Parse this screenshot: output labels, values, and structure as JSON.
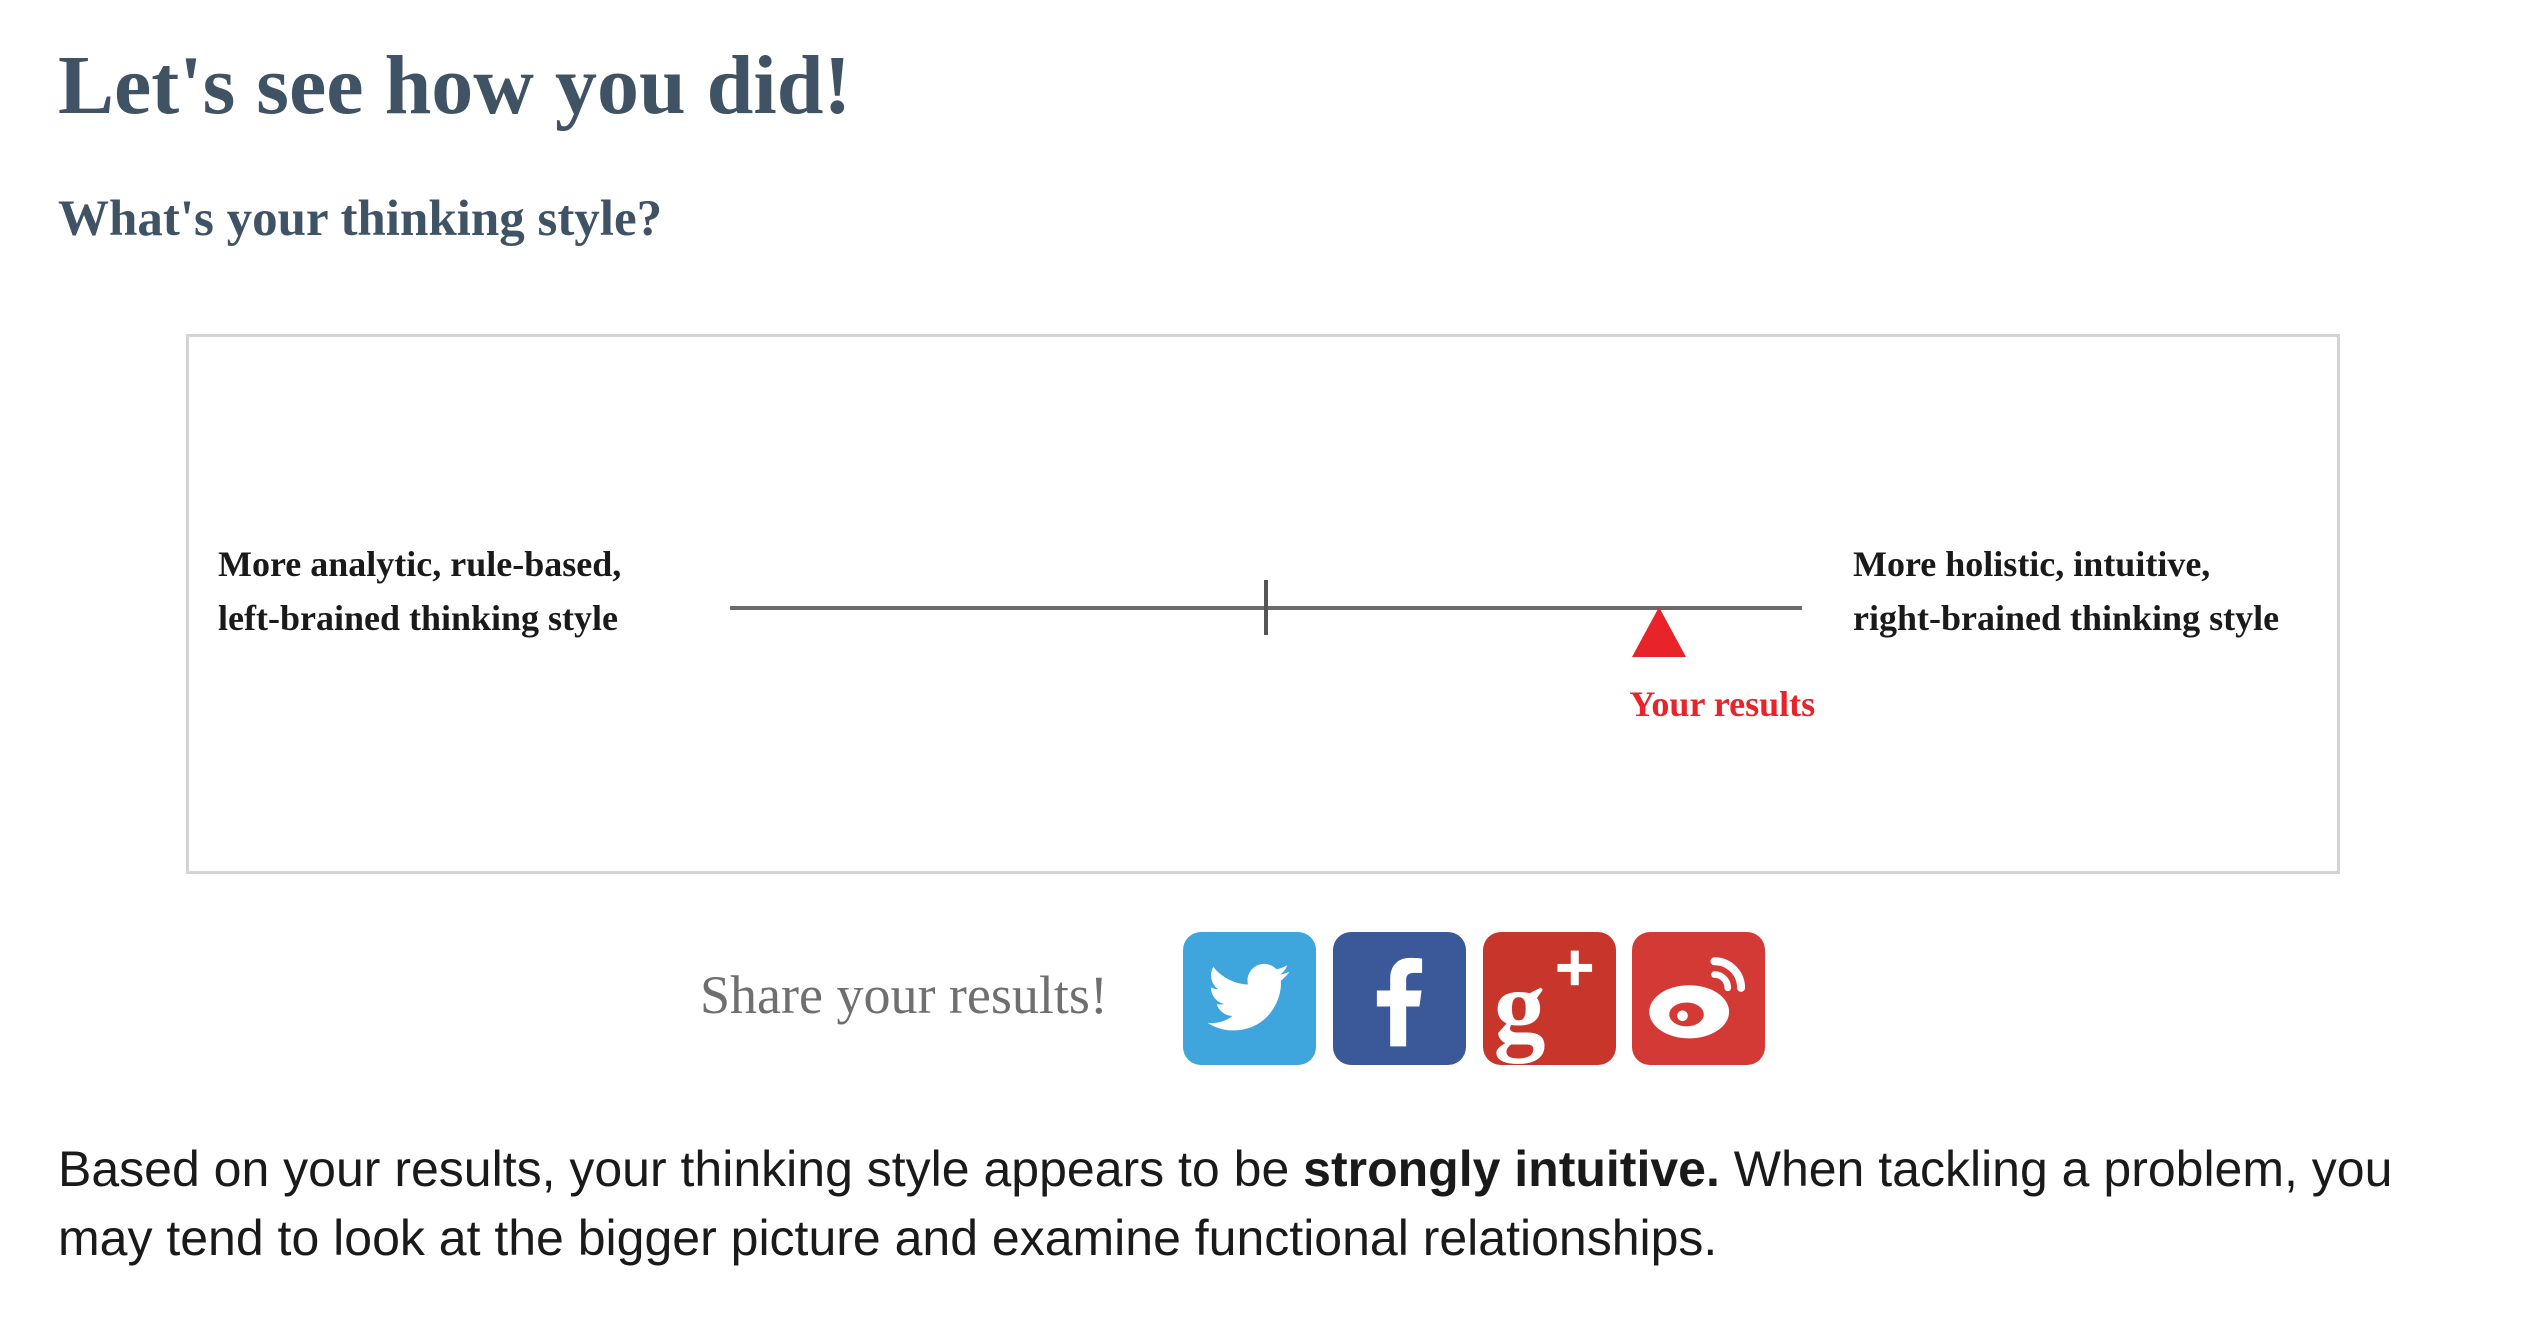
{
  "header": {
    "title": "Let's see how you did!",
    "subtitle": "What's your thinking style?"
  },
  "result_scale": {
    "left_label_line1": "More analytic, rule-based,",
    "left_label_line2": "left-brained thinking style",
    "right_label_line1": "More holistic, intuitive,",
    "right_label_line2": "right-brained thinking style",
    "marker_label": "Your results",
    "marker_color": "#e8232a",
    "result_position_fraction": 0.867
  },
  "share": {
    "label": "Share your results!",
    "buttons": [
      {
        "name": "twitter",
        "icon": "twitter-bird-icon",
        "color": "#3ea6dd"
      },
      {
        "name": "facebook",
        "icon": "facebook-f-icon",
        "color": "#3b5998"
      },
      {
        "name": "google-plus",
        "icon": "google-plus-icon",
        "color": "#c8362b"
      },
      {
        "name": "weibo",
        "icon": "weibo-eye-icon",
        "color": "#d33a35"
      }
    ]
  },
  "result_summary": {
    "prefix": "Based on your results, your thinking style appears to be ",
    "emphasis": "strongly intuitive.",
    "suffix": " When tackling a problem, you may tend to look at the bigger picture and examine functional relationships."
  }
}
